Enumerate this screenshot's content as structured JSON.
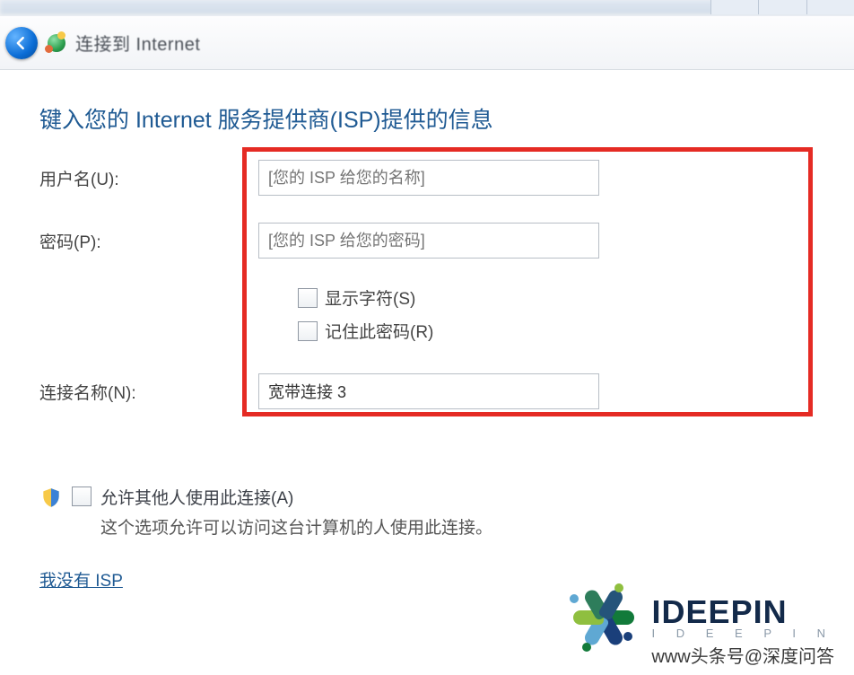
{
  "window": {
    "title": "连接到 Internet"
  },
  "page": {
    "heading": "键入您的 Internet 服务提供商(ISP)提供的信息"
  },
  "form": {
    "username_label": "用户名(U):",
    "username_placeholder": "[您的 ISP 给您的名称]",
    "password_label": "密码(P):",
    "password_placeholder": "[您的 ISP 给您的密码]",
    "show_chars_label": "显示字符(S)",
    "remember_pw_label": "记住此密码(R)",
    "conn_name_label": "连接名称(N):",
    "conn_name_value": "宽带连接 3"
  },
  "allow": {
    "label": "允许其他人使用此连接(A)",
    "desc": "这个选项允许可以访问这台计算机的人使用此连接。"
  },
  "links": {
    "no_isp": "我没有 ISP"
  },
  "watermark": {
    "logo_main": "IDEEPIN",
    "logo_sub": "I  D  E  E  P  I  N",
    "attribution": "www头条号@深度问答"
  }
}
